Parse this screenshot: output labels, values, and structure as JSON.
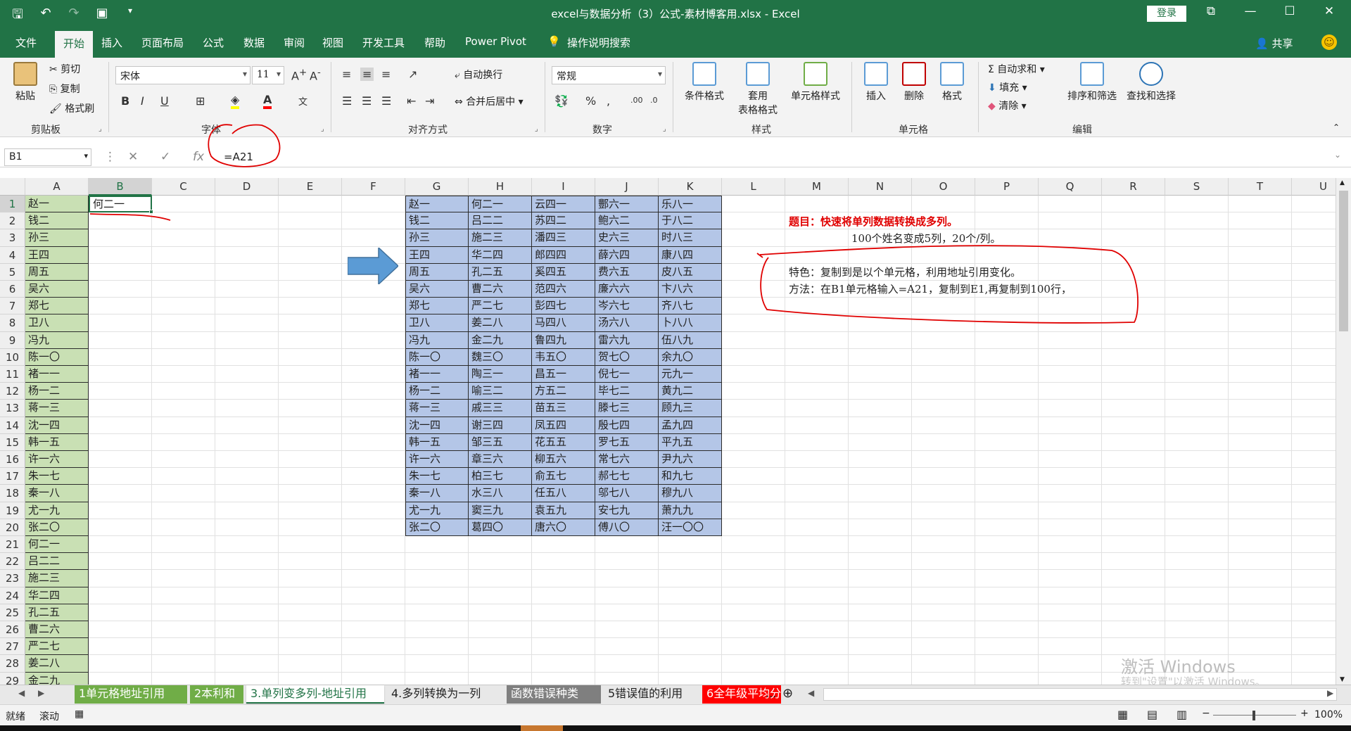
{
  "window": {
    "title": "excel与数据分析（3）公式-素材博客用.xlsx - Excel",
    "login": "登录"
  },
  "tabs": [
    "文件",
    "开始",
    "插入",
    "页面布局",
    "公式",
    "数据",
    "审阅",
    "视图",
    "开发工具",
    "帮助",
    "Power Pivot",
    "操作说明搜索"
  ],
  "active_tab": "开始",
  "share": "共享",
  "ribbon": {
    "clipboard": {
      "paste": "粘贴",
      "cut": "剪切",
      "copy": "复制",
      "format_painter": "格式刷",
      "label": "剪贴板"
    },
    "font": {
      "name": "宋体",
      "size": "11",
      "label": "字体",
      "bold": "B",
      "italic": "I",
      "underline": "U"
    },
    "alignment": {
      "wrap": "自动换行",
      "merge": "合并后居中",
      "label": "对齐方式"
    },
    "number": {
      "format": "常规",
      "label": "数字"
    },
    "styles": {
      "conditional": "条件格式",
      "table_1": "套用",
      "table_2": "表格格式",
      "cell_styles": "单元格样式",
      "label": "样式"
    },
    "cells": {
      "insert": "插入",
      "delete": "删除",
      "format": "格式",
      "label": "单元格"
    },
    "editing": {
      "autosum": "自动求和",
      "fill": "填充",
      "clear": "清除",
      "sort": "排序和筛选",
      "find": "查找和选择",
      "label": "编辑"
    }
  },
  "formula_bar": {
    "name_box": "B1",
    "formula": "=A21",
    "fx": "fx"
  },
  "columns": [
    "A",
    "B",
    "C",
    "D",
    "E",
    "F",
    "G",
    "H",
    "I",
    "J",
    "K",
    "L",
    "M",
    "N",
    "O",
    "P",
    "Q",
    "R",
    "S",
    "T",
    "U"
  ],
  "selected_column": "B",
  "rows": [
    "1",
    "2",
    "3",
    "4",
    "5",
    "6",
    "7",
    "8",
    "9",
    "10",
    "11",
    "12",
    "13",
    "14",
    "15",
    "16",
    "17",
    "18",
    "19",
    "20",
    "21",
    "22",
    "23",
    "24",
    "25",
    "26",
    "27",
    "28",
    "29"
  ],
  "col_A": [
    "赵一",
    "钱二",
    "孙三",
    "王四",
    "周五",
    "吴六",
    "郑七",
    "卫八",
    "冯九",
    "陈一〇",
    "褚一一",
    "杨一二",
    "蒋一三",
    "沈一四",
    "韩一五",
    "许一六",
    "朱一七",
    "秦一八",
    "尤一九",
    "张二〇",
    "何二一",
    "吕二二",
    "施二三",
    "华二四",
    "孔二五",
    "曹二六",
    "严二七",
    "姜二八",
    "金二九"
  ],
  "cell_B1": "何二一",
  "table_G_K": [
    [
      "赵一",
      "何二一",
      "云四一",
      "酆六一",
      "乐八一"
    ],
    [
      "钱二",
      "吕二二",
      "苏四二",
      "鲍六二",
      "于八二"
    ],
    [
      "孙三",
      "施二三",
      "潘四三",
      "史六三",
      "时八三"
    ],
    [
      "王四",
      "华二四",
      "郎四四",
      "薛六四",
      "康八四"
    ],
    [
      "周五",
      "孔二五",
      "奚四五",
      "费六五",
      "皮八五"
    ],
    [
      "吴六",
      "曹二六",
      "范四六",
      "廉六六",
      "卞八六"
    ],
    [
      "郑七",
      "严二七",
      "彭四七",
      "岑六七",
      "齐八七"
    ],
    [
      "卫八",
      "姜二八",
      "马四八",
      "汤六八",
      "卜八八"
    ],
    [
      "冯九",
      "金二九",
      "鲁四九",
      "雷六九",
      "伍八九"
    ],
    [
      "陈一〇",
      "魏三〇",
      "韦五〇",
      "贺七〇",
      "余九〇"
    ],
    [
      "褚一一",
      "陶三一",
      "昌五一",
      "倪七一",
      "元九一"
    ],
    [
      "杨一二",
      "喻三二",
      "方五二",
      "毕七二",
      "黄九二"
    ],
    [
      "蒋一三",
      "戚三三",
      "苗五三",
      "滕七三",
      "顾九三"
    ],
    [
      "沈一四",
      "谢三四",
      "凤五四",
      "殷七四",
      "孟九四"
    ],
    [
      "韩一五",
      "邹三五",
      "花五五",
      "罗七五",
      "平九五"
    ],
    [
      "许一六",
      "章三六",
      "柳五六",
      "常七六",
      "尹九六"
    ],
    [
      "朱一七",
      "柏三七",
      "俞五七",
      "郝七七",
      "和九七"
    ],
    [
      "秦一八",
      "水三八",
      "任五八",
      "邬七八",
      "穆九八"
    ],
    [
      "尤一九",
      "窦三九",
      "袁五九",
      "安七九",
      "萧九九"
    ],
    [
      "张二〇",
      "葛四〇",
      "唐六〇",
      "傅八〇",
      "汪一〇〇"
    ]
  ],
  "notes": {
    "title": "题目：快速将单列数据转换成多列。",
    "subtitle": "100个姓名变成5列，20个/列。",
    "feature": "特色：复制到是以个单元格，利用地址引用变化。",
    "method": "方法：在B1单元格输入=A21，复制到E1,再复制到100行，"
  },
  "watermark": {
    "line1": "激活 Windows",
    "line2": "转到\"设置\"以激活 Windows。"
  },
  "sheet_tabs": [
    {
      "label": "1单元格地址引用",
      "bg": "#70ad47",
      "fg": "#ffffff"
    },
    {
      "label": "2本利和",
      "bg": "#70ad47",
      "fg": "#ffffff"
    },
    {
      "label": "3.单列变多列-地址引用",
      "bg": "#ffffff",
      "fg": "#217346"
    },
    {
      "label": "4.多列转换为一列",
      "bg": "#e8e8e8",
      "fg": "#222222"
    },
    {
      "label": "函数错误种类",
      "bg": "#7f7f7f",
      "fg": "#ffffff"
    },
    {
      "label": "5错误值的利用",
      "bg": "#e8e8e8",
      "fg": "#222222"
    },
    {
      "label": "6全年级平均分",
      "bg": "#ff0000",
      "fg": "#ffffff"
    }
  ],
  "sheet_more": "...",
  "status": {
    "ready": "就绪",
    "scroll": "滚动",
    "zoom": "100%"
  }
}
